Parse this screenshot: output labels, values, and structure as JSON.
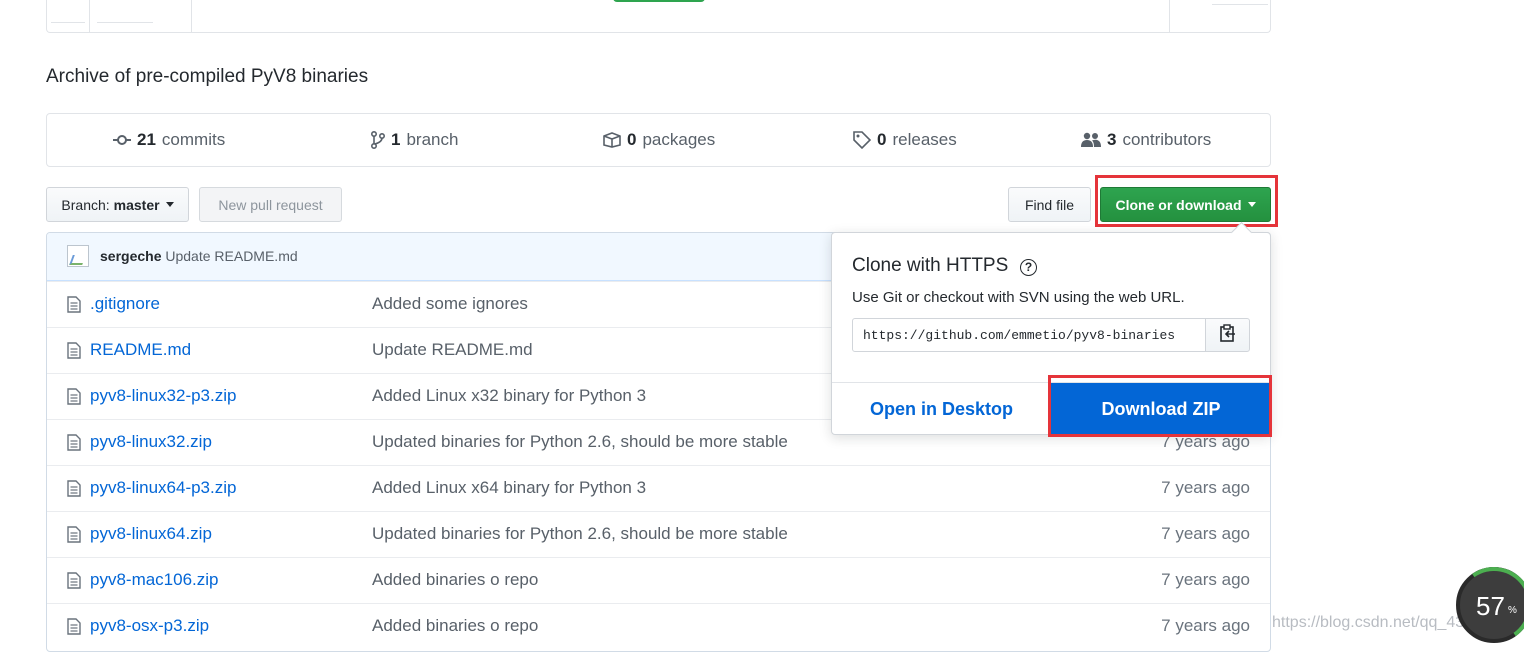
{
  "repo": {
    "description": "Archive of pre-compiled PyV8 binaries"
  },
  "summary": {
    "commits": {
      "count": "21",
      "label": "commits"
    },
    "branches": {
      "count": "1",
      "label": "branch"
    },
    "packages": {
      "count": "0",
      "label": "packages"
    },
    "releases": {
      "count": "0",
      "label": "releases"
    },
    "contributors": {
      "count": "3",
      "label": "contributors"
    }
  },
  "toolbar": {
    "branch_prefix": "Branch:",
    "branch_name": "master",
    "new_pr_label": "New pull request",
    "find_file_label": "Find file",
    "clone_label": "Clone or download"
  },
  "commit_tease": {
    "author": "sergeche",
    "message": "Update README.md"
  },
  "files": [
    {
      "name": ".gitignore",
      "message": "Added some ignores",
      "age": ""
    },
    {
      "name": "README.md",
      "message": "Update README.md",
      "age": ""
    },
    {
      "name": "pyv8-linux32-p3.zip",
      "message": "Added Linux x32 binary for Python 3",
      "age": ""
    },
    {
      "name": "pyv8-linux32.zip",
      "message": "Updated binaries for Python 2.6, should be more stable",
      "age": "7 years ago"
    },
    {
      "name": "pyv8-linux64-p3.zip",
      "message": "Added Linux x64 binary for Python 3",
      "age": "7 years ago"
    },
    {
      "name": "pyv8-linux64.zip",
      "message": "Updated binaries for Python 2.6, should be more stable",
      "age": "7 years ago"
    },
    {
      "name": "pyv8-mac106.zip",
      "message": "Added binaries o repo",
      "age": "7 years ago"
    },
    {
      "name": "pyv8-osx-p3.zip",
      "message": "Added binaries o repo",
      "age": "7 years ago"
    }
  ],
  "clone": {
    "title": "Clone with HTTPS",
    "help_glyph": "?",
    "subtitle": "Use Git or checkout with SVN using the web URL.",
    "url": "https://github.com/emmetio/pyv8-binaries",
    "open_desktop_label": "Open in Desktop",
    "download_zip_label": "Download ZIP"
  },
  "overlays": {
    "watermark": "https://blog.csdn.net/qq_43801351",
    "zoom_value": "57",
    "zoom_unit": "%"
  },
  "colors": {
    "link": "#0366d6",
    "green_button": "#2ea44f",
    "highlight_box": "#e5343a"
  },
  "icons": [
    "commit-icon",
    "branch-icon",
    "package-icon",
    "tag-icon",
    "people-icon",
    "file-icon",
    "clipboard-icon",
    "help-icon"
  ]
}
